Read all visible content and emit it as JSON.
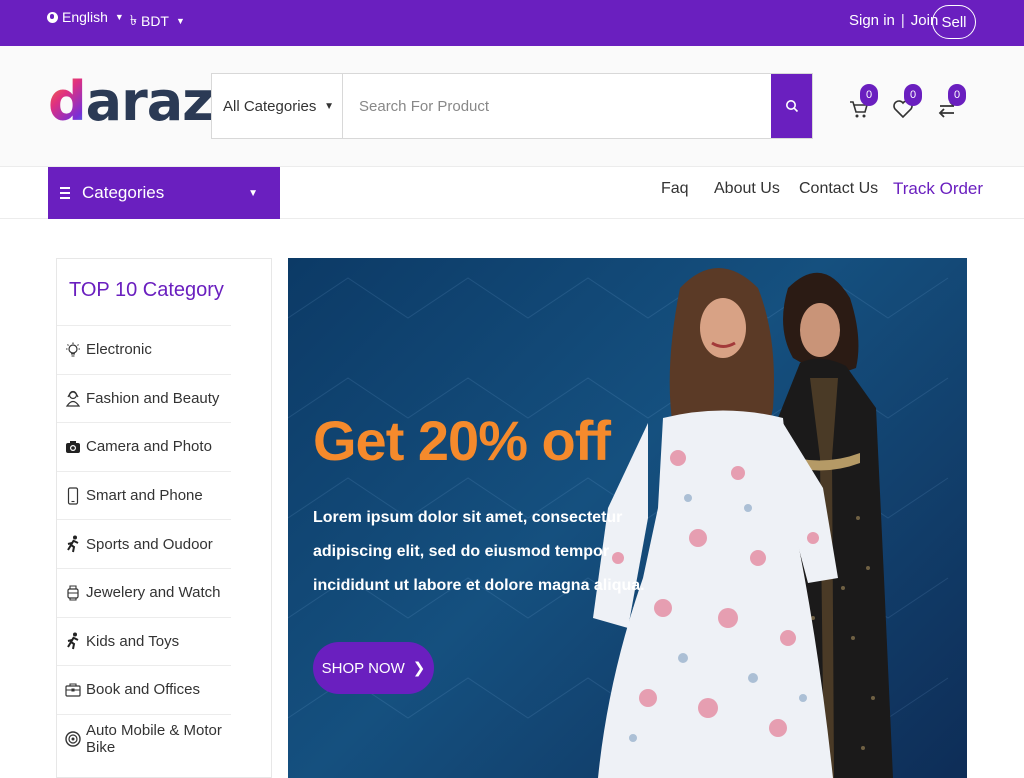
{
  "topbar": {
    "language": "English",
    "currency": "BDT",
    "signin": "Sign in",
    "separator": "|",
    "join": "Join",
    "sell": "Sell"
  },
  "header": {
    "logo_first": "d",
    "logo_rest": "araz",
    "category_select": "All Categories",
    "search_placeholder": "Search For Product",
    "cart_count": "0",
    "wishlist_count": "0",
    "compare_count": "0"
  },
  "nav": {
    "categories_label": "Categories",
    "links": [
      "Faq",
      "About Us",
      "Contact Us",
      "Track Order"
    ]
  },
  "sidebar": {
    "title": "TOP 10 Category",
    "items": [
      {
        "label": "Electronic",
        "icon": "bulb-icon"
      },
      {
        "label": "Fashion and Beauty",
        "icon": "person-icon"
      },
      {
        "label": "Camera and Photo",
        "icon": "camera-icon"
      },
      {
        "label": "Smart and Phone",
        "icon": "phone-icon"
      },
      {
        "label": "Sports and Oudoor",
        "icon": "runner-icon"
      },
      {
        "label": "Jewelery and Watch",
        "icon": "watch-icon"
      },
      {
        "label": "Kids and Toys",
        "icon": "runner-icon"
      },
      {
        "label": "Book and Offices",
        "icon": "briefcase-icon"
      },
      {
        "label": "Auto Mobile & Motor Bike",
        "icon": "wheel-icon"
      }
    ]
  },
  "banner": {
    "headline": "Get 20% off",
    "text": "Lorem ipsum dolor sit amet, consectetur adipiscing elit, sed do eiusmod tempor incididunt ut labore et dolore magna aliqua.",
    "button": "SHOP NOW",
    "button_arrow": "❯"
  },
  "colors": {
    "brand": "#6a1fbf",
    "accent": "#f58a2c",
    "banner_bg": "#15507f"
  }
}
